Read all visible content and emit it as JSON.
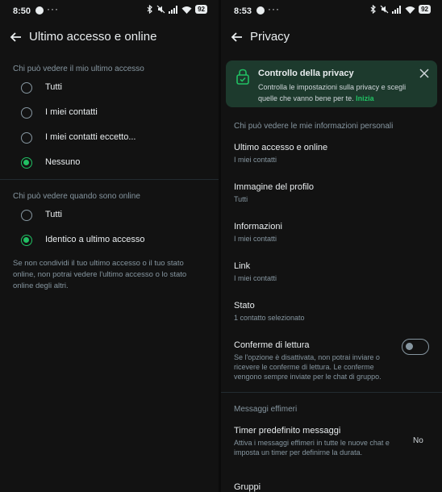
{
  "left_screen": {
    "status": {
      "time": "8:50",
      "battery": "92"
    },
    "appbar": {
      "title": "Ultimo accesso e online"
    },
    "last_seen": {
      "label": "Chi può vedere il mio ultimo accesso",
      "options": [
        {
          "label": "Tutti",
          "selected": false
        },
        {
          "label": "I miei contatti",
          "selected": false
        },
        {
          "label": "I miei contatti eccetto...",
          "selected": false
        },
        {
          "label": "Nessuno",
          "selected": true
        }
      ]
    },
    "online": {
      "label": "Chi può vedere quando sono online",
      "options": [
        {
          "label": "Tutti",
          "selected": false
        },
        {
          "label": "Identico a ultimo accesso",
          "selected": true
        }
      ]
    },
    "note": "Se non condividi il tuo ultimo accesso o il tuo stato online, non potrai vedere l'ultimo accesso o lo stato online degli altri."
  },
  "right_screen": {
    "status": {
      "time": "8:53",
      "battery": "92"
    },
    "appbar": {
      "title": "Privacy"
    },
    "banner": {
      "title": "Controllo della privacy",
      "text": "Controlla le impostazioni sulla privacy e scegli quelle che vanno bene per te.",
      "cta": "Inizia"
    },
    "section_personal": "Chi può vedere le mie informazioni personali",
    "items": [
      {
        "title": "Ultimo accesso e online",
        "subtitle": "I miei contatti"
      },
      {
        "title": "Immagine del profilo",
        "subtitle": "Tutti"
      },
      {
        "title": "Informazioni",
        "subtitle": "I miei contatti"
      },
      {
        "title": "Link",
        "subtitle": "I miei contatti"
      },
      {
        "title": "Stato",
        "subtitle": "1 contatto selezionato"
      }
    ],
    "read_receipts": {
      "title": "Conferme di lettura",
      "subtitle": "Se l'opzione è disattivata, non potrai inviare o ricevere le conferme di lettura. Le conferme vengono sempre inviate per le chat di gruppo.",
      "enabled": false
    },
    "section_ephemeral": "Messaggi effimeri",
    "timer": {
      "title": "Timer predefinito messaggi",
      "subtitle": "Attiva i messaggi effimeri in tutte le nuove chat e imposta un timer per definirne la durata.",
      "value": "No"
    },
    "groups": {
      "title": "Gruppi"
    }
  },
  "colors": {
    "accent": "#21c063",
    "background": "#121212",
    "banner": "#1d3a2d",
    "secondary_text": "#8696a0"
  }
}
